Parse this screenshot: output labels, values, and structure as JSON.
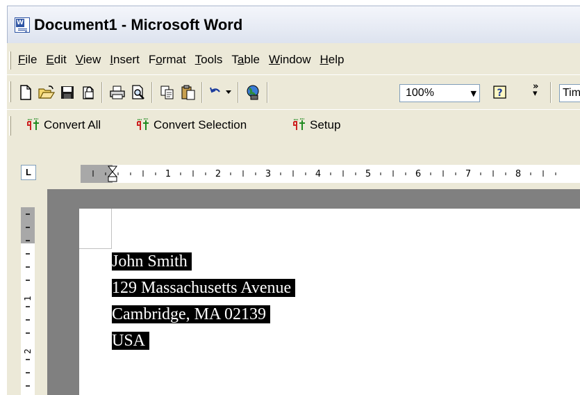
{
  "window": {
    "title": "Document1 - Microsoft Word"
  },
  "menu": [
    {
      "pre": "",
      "u": "F",
      "post": "ile"
    },
    {
      "pre": "",
      "u": "E",
      "post": "dit"
    },
    {
      "pre": "",
      "u": "V",
      "post": "iew"
    },
    {
      "pre": "",
      "u": "I",
      "post": "nsert"
    },
    {
      "pre": "F",
      "u": "o",
      "post": "rmat"
    },
    {
      "pre": "",
      "u": "T",
      "post": "ools"
    },
    {
      "pre": "T",
      "u": "a",
      "post": "ble"
    },
    {
      "pre": "",
      "u": "W",
      "post": "indow"
    },
    {
      "pre": "",
      "u": "H",
      "post": "elp"
    }
  ],
  "toolbar": {
    "zoom": "100%",
    "font": "Times New Roman",
    "icons": [
      "new-document-icon",
      "open-folder-icon",
      "save-icon",
      "permission-icon",
      "print-icon",
      "print-preview-icon",
      "copy-icon",
      "paste-icon",
      "undo-icon",
      "undo-dropdown-icon",
      "web-globe-icon",
      "help-icon",
      "toolbar-options-icon"
    ]
  },
  "plugin_toolbar": {
    "convert_all": "Convert All",
    "convert_selection": "Convert Selection",
    "setup": "Setup"
  },
  "ruler": {
    "tab_selector": "L",
    "horizontal_numbers": [
      "1",
      "2",
      "3",
      "4",
      "5",
      "6",
      "7",
      "8"
    ],
    "vertical_numbers": [
      "1",
      "2"
    ]
  },
  "document": {
    "lines": [
      "John Smith",
      "129 Massachusetts Avenue",
      "Cambridge, MA 02139",
      "USA"
    ],
    "selection_color": "#000000"
  },
  "colors": {
    "chrome": "#ece9d8",
    "workspace": "#808080",
    "accent_blue": "#2f55a4"
  }
}
